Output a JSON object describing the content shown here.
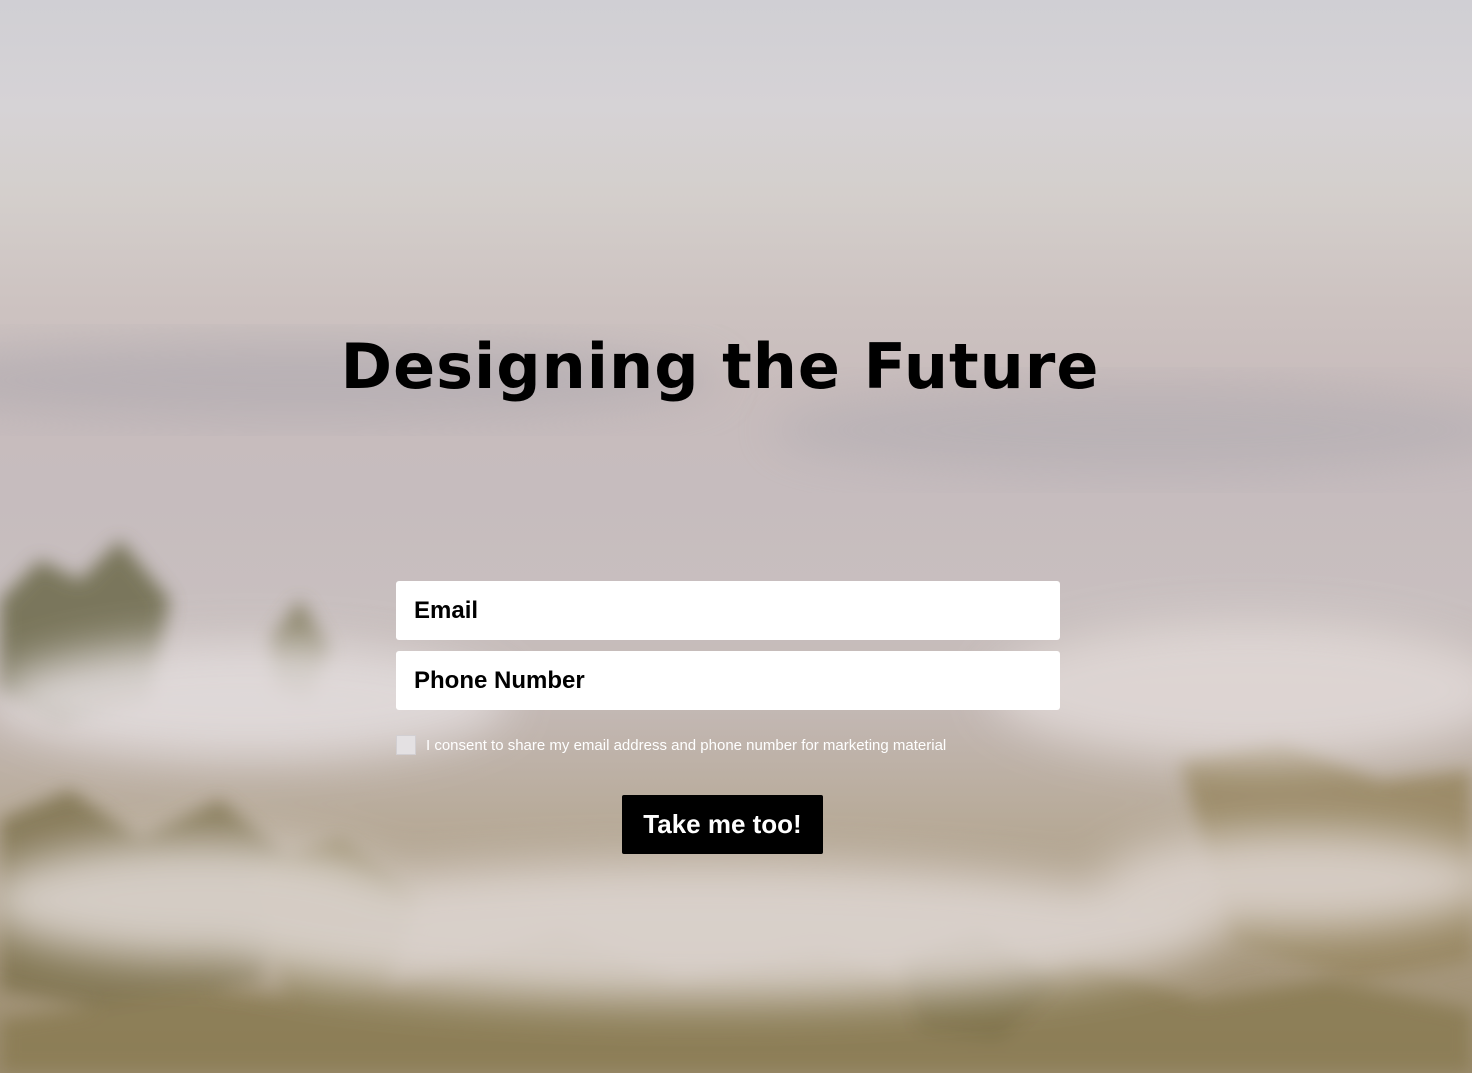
{
  "hero": {
    "title": "Designing the Future"
  },
  "form": {
    "email_placeholder": "Email",
    "phone_placeholder": "Phone Number",
    "consent_label": "I consent to share my email address and phone number for marketing material",
    "consent_checked": false,
    "submit_label": "Take me too!"
  },
  "background": {
    "description_icon": "foggy-forest-image",
    "colors": {
      "sky": "#d4d1d5",
      "fog": "#c8bdbd",
      "trees": "#8a7d55"
    }
  }
}
